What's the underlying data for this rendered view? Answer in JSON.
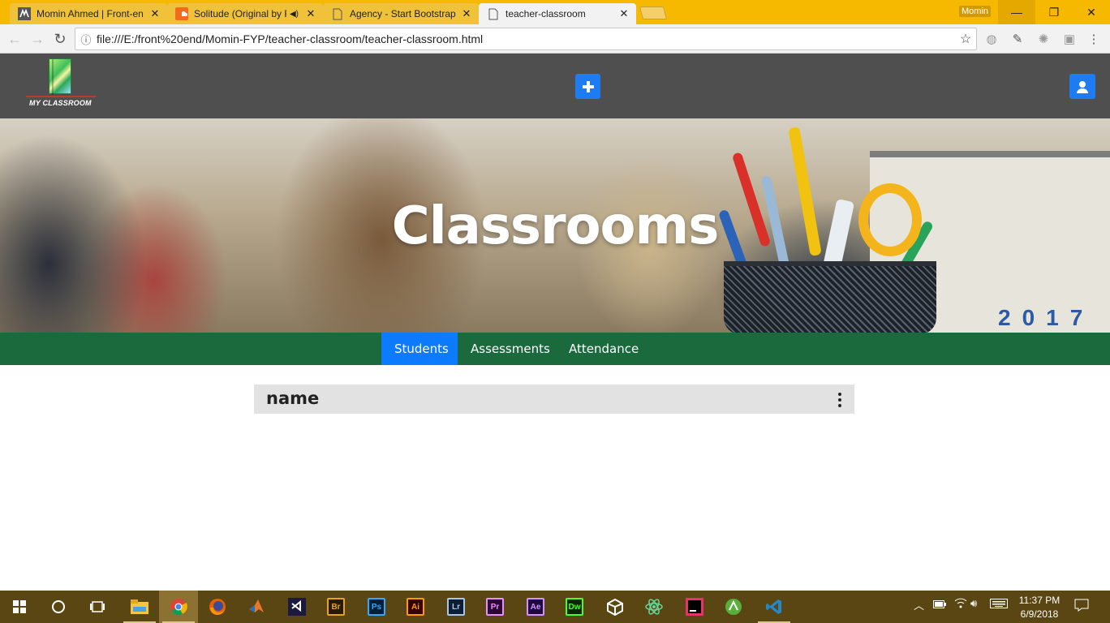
{
  "browser": {
    "tabs": [
      {
        "title": "Momin Ahmed | Front-en",
        "icon": "m-logo-icon"
      },
      {
        "title": "Solitude (Original by F",
        "icon": "soundcloud-icon"
      },
      {
        "title": "Agency - Start Bootstrap",
        "icon": "page-icon"
      },
      {
        "title": "teacher-classroom",
        "icon": "page-icon"
      }
    ],
    "profile_name": "Momin",
    "url": "file:///E:/front%20end/Momin-FYP/teacher-classroom/teacher-classroom.html"
  },
  "navbar": {
    "logo_text": "MY CLASSROOM",
    "add_icon": "plus-icon",
    "user_icon": "user-icon"
  },
  "hero": {
    "title": "Classrooms",
    "calendar_year": "2017"
  },
  "page_tabs": [
    {
      "label": "Students",
      "active": true
    },
    {
      "label": "Assessments",
      "active": false
    },
    {
      "label": "Attendance",
      "active": false
    }
  ],
  "list": {
    "header": "name"
  },
  "taskbar": {
    "apps": [
      "file-explorer",
      "chrome",
      "firefox",
      "matlab",
      "visual-studio",
      "Br",
      "Ps",
      "Ai",
      "Lr",
      "Pr",
      "Ae",
      "Dw",
      "unity",
      "atom",
      "intellij",
      "android-studio",
      "vscode"
    ],
    "time": "11:37 PM",
    "date": "6/9/2018"
  },
  "colors": {
    "chrome_frame": "#f7b900",
    "navbar": "#4f4f4f",
    "tabbar": "#1a6a3e",
    "accent": "#0d7bff"
  }
}
